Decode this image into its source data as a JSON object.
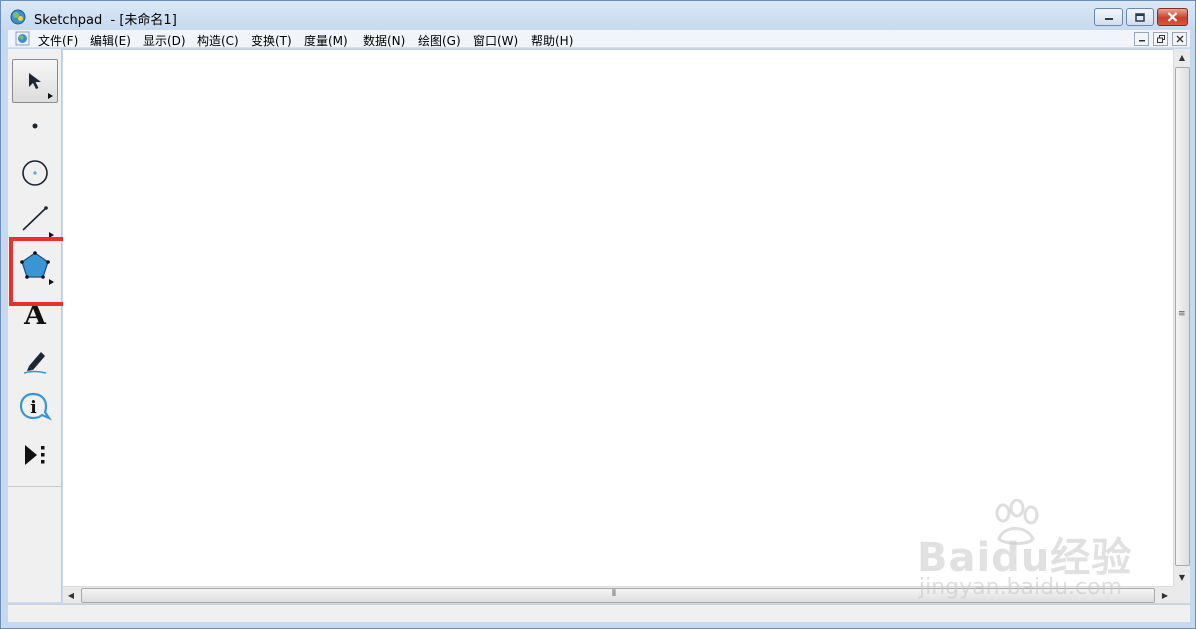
{
  "window": {
    "title": "Sketchpad  - [未命名1]",
    "controls": {
      "minimize": "minimize-icon",
      "maximize": "maximize-icon",
      "close": "close-icon"
    }
  },
  "menubar": {
    "items": [
      "文件(F)",
      "编辑(E)",
      "显示(D)",
      "构造(C)",
      "变换(T)",
      "度量(M)",
      "数据(N)",
      "绘图(G)",
      "窗口(W)",
      "帮助(H)"
    ]
  },
  "toolbox": {
    "tools": [
      {
        "name": "selection-arrow-tool",
        "icon": "arrow-pointer-icon",
        "active": true,
        "has_submenu": true
      },
      {
        "name": "point-tool",
        "icon": "point-icon",
        "active": false,
        "has_submenu": false
      },
      {
        "name": "compass-tool",
        "icon": "circle-icon",
        "active": false,
        "has_submenu": false
      },
      {
        "name": "straightedge-tool",
        "icon": "line-segment-icon",
        "active": false,
        "has_submenu": true
      },
      {
        "name": "polygon-tool",
        "icon": "polygon-icon",
        "active": false,
        "has_submenu": true,
        "highlighted": true
      },
      {
        "name": "text-tool",
        "icon": "text-a-icon",
        "label": "A",
        "active": false
      },
      {
        "name": "marker-tool",
        "icon": "marker-pen-icon",
        "active": false
      },
      {
        "name": "information-tool",
        "icon": "info-icon",
        "label": "i",
        "active": false
      },
      {
        "name": "custom-tool",
        "icon": "play-custom-icon",
        "active": false
      }
    ]
  },
  "watermark": {
    "brand": "Baidu经验",
    "url": "jingyan.baidu.com"
  },
  "colors": {
    "highlight": "#e8312b",
    "polygon_fill": "#3a95d4",
    "canvas": "#ffffff"
  }
}
